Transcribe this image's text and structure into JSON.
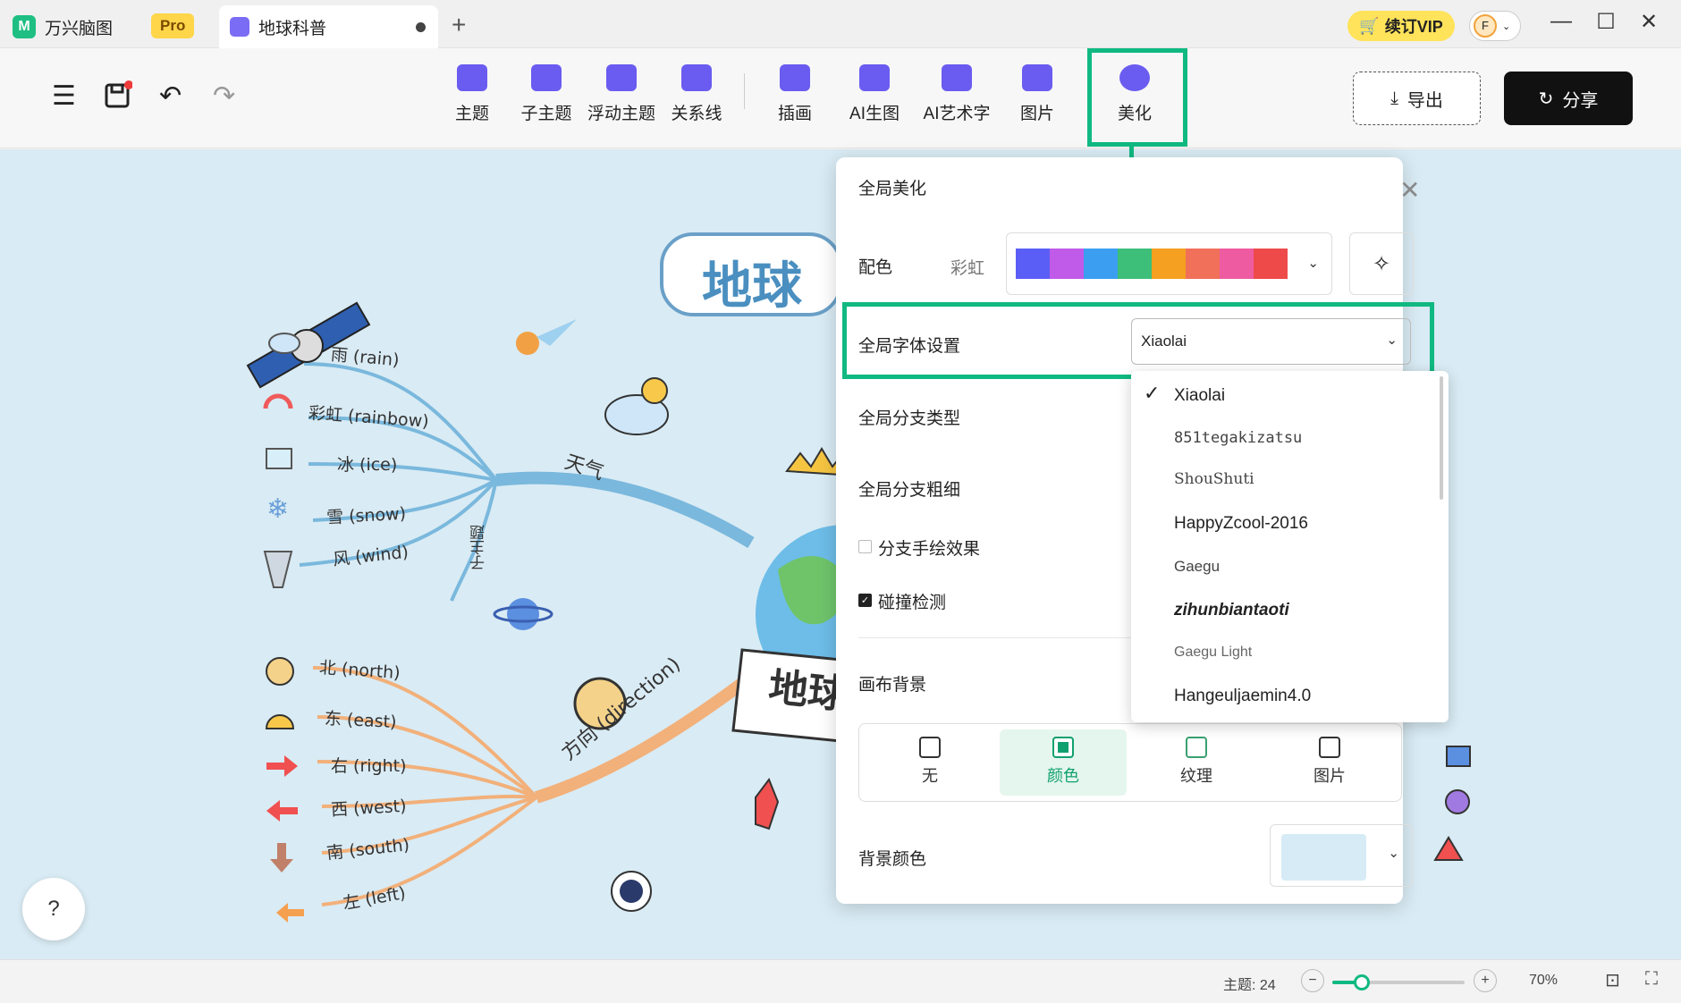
{
  "tabs": {
    "app_name": "万兴脑图",
    "pro_badge": "Pro",
    "doc_name": "地球科普",
    "new_tab": "+"
  },
  "titlebar": {
    "vip_label": "续订VIP",
    "avatar_letter": "F"
  },
  "toolbar": {
    "tools": [
      "主题",
      "子主题",
      "浮动主题",
      "关系线",
      "插画",
      "AI生图",
      "AI艺术字",
      "图片",
      "美化"
    ],
    "export_label": "导出",
    "share_label": "分享"
  },
  "mindmap": {
    "title": "地球",
    "center_label": "地球",
    "weather_branch": "天气",
    "subtopic": "子主题",
    "direction_branch": "方向 (direction)",
    "weather_items": [
      "雨 (rain)",
      "彩虹 (rainbow)",
      "冰 (ice)",
      "雪 (snow)",
      "风 (wind)"
    ],
    "direction_items": [
      "北 (north)",
      "东 (east)",
      "右 (right)",
      "西 (west)",
      "南 (south)",
      "左 (left)"
    ]
  },
  "panel": {
    "title": "全局美化",
    "color_label": "配色",
    "color_scheme": "彩虹",
    "palette": [
      "#5b5ef6",
      "#c05ae8",
      "#3b9ef0",
      "#3dbf7a",
      "#f5a020",
      "#f0705a",
      "#ee5ba0",
      "#ee4a4a"
    ],
    "font_label": "全局字体设置",
    "font_value": "Xiaolai",
    "branch_type_label": "全局分支类型",
    "branch_width_label": "全局分支粗细",
    "handdrawn_label": "分支手绘效果",
    "handdrawn_checked": false,
    "collision_label": "碰撞检测",
    "collision_checked": true,
    "canvas_bg_label": "画布背景",
    "bg_options": [
      "无",
      "颜色",
      "纹理",
      "图片"
    ],
    "bg_selected": "颜色",
    "bg_color_label": "背景颜色",
    "bg_color": "#d6ebf5"
  },
  "font_list": {
    "selected": "Xiaolai",
    "items": [
      "Xiaolai",
      "851tegakizatsu",
      "ShouShuti",
      "HappyZcool-2016",
      "Gaegu",
      "zihunbiantaoti",
      "Gaegu Light",
      "Hangeuljaemin4.0"
    ]
  },
  "statusbar": {
    "topic_count": "主题: 24",
    "zoom": "70%",
    "zoom_level_fraction": 0.22
  },
  "accent_color": "#10b981"
}
